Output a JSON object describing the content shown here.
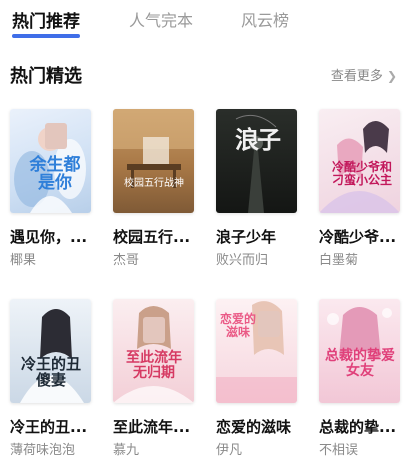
{
  "tabs": [
    {
      "label": "热门推荐",
      "active": true
    },
    {
      "label": "人气完本",
      "active": false
    },
    {
      "label": "风云榜",
      "active": false
    }
  ],
  "section": {
    "title": "热门精选",
    "more_label": "查看更多",
    "more_icon": "chevron-right-icon"
  },
  "books": [
    {
      "title": "遇见你，...",
      "author": "椰果",
      "cover_text": "余生都是你",
      "cover_bg": "#dfe9f7",
      "cover_accent": "#3f8ee6"
    },
    {
      "title": "校园五行...",
      "author": "杰哥",
      "cover_text": "校园五行战神",
      "cover_bg": "#b58a5a",
      "cover_accent": "#ffffff"
    },
    {
      "title": "浪子少年",
      "author": "败兴而归",
      "cover_text": "浪子",
      "cover_bg": "#1c1f1c",
      "cover_accent": "#f2f2f2"
    },
    {
      "title": "冷酷少爷...",
      "author": "白墨菊",
      "cover_text": "冷酷少爷和刁蛮小公主",
      "cover_bg": "#f3dde6",
      "cover_accent": "#c2185b"
    },
    {
      "title": "冷王的丑...",
      "author": "薄荷味泡泡",
      "cover_text": "冷王的丑傻妻",
      "cover_bg": "#d9e4ef",
      "cover_accent": "#2a3b4a"
    },
    {
      "title": "至此流年...",
      "author": "慕九",
      "cover_text": "至此流年无归期",
      "cover_bg": "#f6dfe3",
      "cover_accent": "#d63a63"
    },
    {
      "title": "恋爱的滋味",
      "author": "伊凡",
      "cover_text": "恋爱的滋味",
      "cover_bg": "#f9e6ea",
      "cover_accent": "#ea5a86"
    },
    {
      "title": "总裁的挚...",
      "author": "不相误",
      "cover_text": "总裁的挚爱女友",
      "cover_bg": "#f8dbe4",
      "cover_accent": "#e0407a"
    }
  ]
}
